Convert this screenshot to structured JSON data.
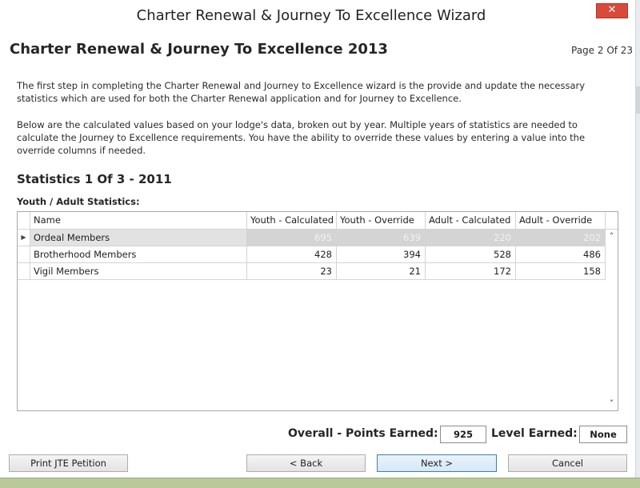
{
  "window": {
    "title": "Charter Renewal & Journey To Excellence Wizard",
    "close_glyph": "✕"
  },
  "page": {
    "heading": "Charter Renewal & Journey To Excellence 2013",
    "counter": "Page 2 Of 23",
    "paragraph1": "The first step in completing the Charter Renewal and Journey to Excellence wizard is the provide and update the necessary statistics which are used for both the Charter Renewal application and for Journey to Excellence.",
    "paragraph2": "Below are the calculated values based on your lodge's data, broken out by year. Multiple years of statistics are needed to calculate the Journey to Excellence requirements. You have the ability to override these values by entering a value into the override columns if needed.",
    "section_heading": "Statistics 1 Of 3 - 2011",
    "sub_heading": "Youth / Adult Statistics:"
  },
  "grid": {
    "columns": [
      "Name",
      "Youth - Calculated",
      "Youth - Override",
      "Adult - Calculated",
      "Adult - Override"
    ],
    "rows": [
      {
        "name": "Ordeal Members",
        "youth_calc": "695",
        "youth_override": "639",
        "adult_calc": "220",
        "adult_override": "202",
        "selected": true
      },
      {
        "name": "Brotherhood Members",
        "youth_calc": "428",
        "youth_override": "394",
        "adult_calc": "528",
        "adult_override": "486",
        "selected": false
      },
      {
        "name": "Vigil Members",
        "youth_calc": "23",
        "youth_override": "21",
        "adult_calc": "172",
        "adult_override": "158",
        "selected": false
      }
    ],
    "row_indicator_glyph": "▶",
    "scroll_up_glyph": "˄",
    "scroll_down_glyph": "˅"
  },
  "summary": {
    "points_label": "Overall - Points Earned:",
    "points_value": "925",
    "level_label": "Level Earned:",
    "level_value": "None"
  },
  "buttons": {
    "print": "Print JTE Petition",
    "back": "< Back",
    "next": "Next >",
    "cancel": "Cancel"
  },
  "colors": {
    "close_button": "#d84a3a",
    "selected_row": "#d4d4d4",
    "next_button_border": "#3c7fb1",
    "taskbar": "#b9c99a"
  }
}
